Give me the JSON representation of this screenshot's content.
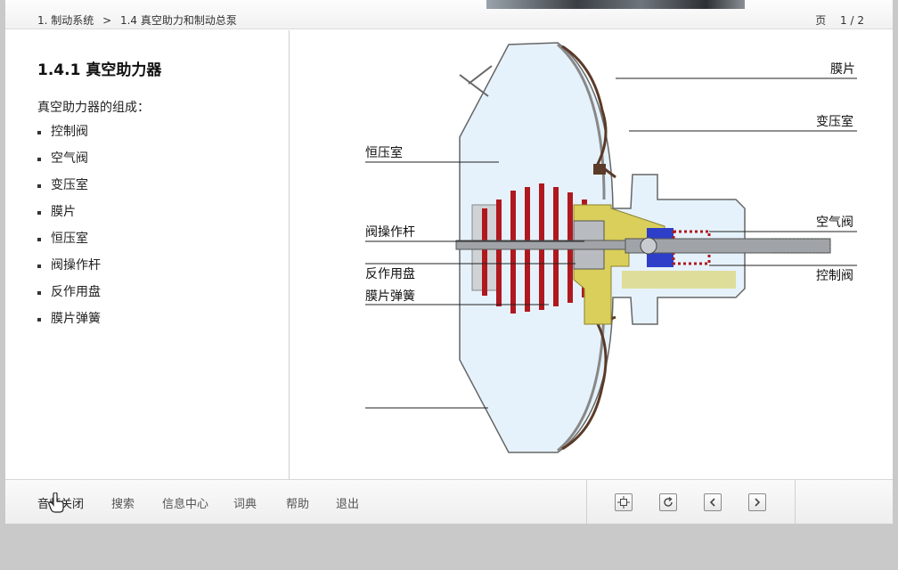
{
  "breadcrumb": {
    "level1": "1. 制动系统",
    "separator": ">",
    "level2": "1.4 真空助力和制动总泵"
  },
  "page_indicator": {
    "label": "页",
    "value": "1 / 2"
  },
  "content": {
    "title": "1.4.1 真空助力器",
    "intro": "真空助力器的组成：",
    "items": [
      "控制阀",
      "空气阀",
      "变压室",
      "膜片",
      "恒压室",
      "阀操作杆",
      "反作用盘",
      "膜片弹簧"
    ]
  },
  "diagram": {
    "right_labels": [
      "膜片",
      "变压室",
      "空气阀",
      "控制阀"
    ],
    "left_labels": [
      "恒压室",
      "阀操作杆",
      "反作用盘",
      "膜片弹簧"
    ]
  },
  "toolbar": {
    "links": [
      "音频关闭",
      "搜索",
      "信息中心",
      "词典",
      "帮助",
      "退出"
    ],
    "nav_icons": [
      "overview-icon",
      "refresh-icon",
      "chevron-left-icon",
      "chevron-right-icon"
    ]
  },
  "colors": {
    "chamber": "#e6f2fb",
    "spring": "#b0181f",
    "plate": "#d9cf5a",
    "valve_blue": "#2d3fc8",
    "rubber": "#5a3a28",
    "rod": "#a0a4a8"
  }
}
